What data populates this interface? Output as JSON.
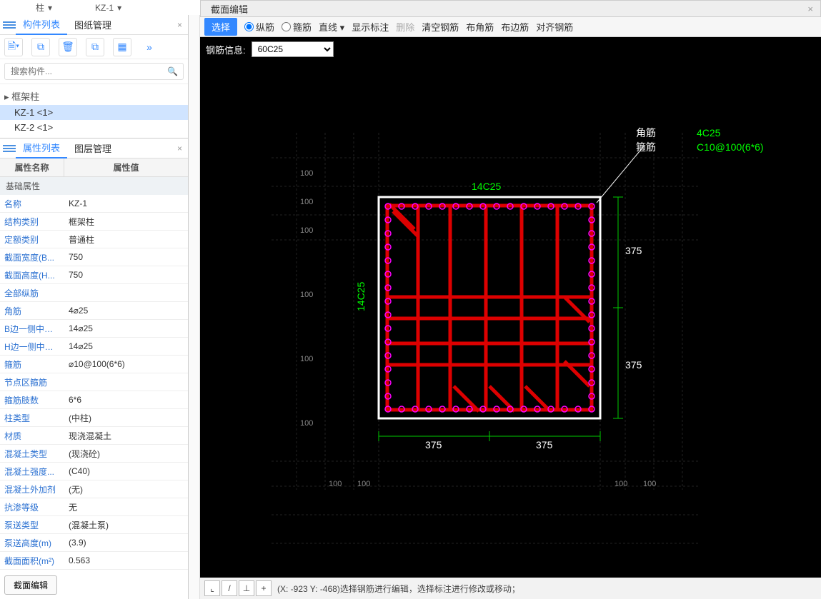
{
  "top": {
    "dd1": "柱",
    "dd2": "KZ-1"
  },
  "left_tabs": {
    "tab1": "构件列表",
    "tab2": "图纸管理"
  },
  "search": {
    "placeholder": "搜索构件..."
  },
  "tree": {
    "group": "框架柱",
    "items": [
      "KZ-1  <1>",
      "KZ-2  <1>"
    ]
  },
  "prop_tabs": {
    "tab1": "属性列表",
    "tab2": "图层管理"
  },
  "prop_head": {
    "c1": "属性名称",
    "c2": "属性值"
  },
  "prop_cat": "基础属性",
  "props": [
    {
      "n": "名称",
      "v": "KZ-1"
    },
    {
      "n": "结构类别",
      "v": "框架柱"
    },
    {
      "n": "定额类别",
      "v": "普通柱"
    },
    {
      "n": "截面宽度(B...",
      "v": "750"
    },
    {
      "n": "截面高度(H...",
      "v": "750"
    },
    {
      "n": "全部纵筋",
      "v": ""
    },
    {
      "n": "角筋",
      "v": "4⌀25"
    },
    {
      "n": "B边一侧中部筋",
      "v": "14⌀25"
    },
    {
      "n": "H边一侧中部筋",
      "v": "14⌀25"
    },
    {
      "n": "箍筋",
      "v": "⌀10@100(6*6)"
    },
    {
      "n": "节点区箍筋",
      "v": ""
    },
    {
      "n": "箍筋肢数",
      "v": "6*6"
    },
    {
      "n": "柱类型",
      "v": "(中柱)"
    },
    {
      "n": "材质",
      "v": "现浇混凝土"
    },
    {
      "n": "混凝土类型",
      "v": "(现浇砼)"
    },
    {
      "n": "混凝土强度...",
      "v": "(C40)"
    },
    {
      "n": "混凝土外加剂",
      "v": "(无)"
    },
    {
      "n": "抗渗等级",
      "v": "无"
    },
    {
      "n": "泵送类型",
      "v": "(混凝土泵)"
    },
    {
      "n": "泵送高度(m)",
      "v": "(3.9)"
    },
    {
      "n": "截面面积(m²)",
      "v": "0.563"
    }
  ],
  "edit_btn": "截面编辑",
  "rp_title": "截面编辑",
  "rp_tool": {
    "select": "选择",
    "long": "纵筋",
    "stirrup": "箍筋",
    "line": "直线",
    "show": "显示标注",
    "del": "删除",
    "clear": "清空钢筋",
    "corner": "布角筋",
    "edge": "布边筋",
    "align": "对齐钢筋"
  },
  "rp_info": {
    "label": "钢筋信息:",
    "val": "60C25"
  },
  "drawing": {
    "top_label": "14C25",
    "left_label": "14C25",
    "right_dims": [
      "375",
      "375"
    ],
    "bottom_dims": [
      "375",
      "375"
    ],
    "grid_labels": [
      "100",
      "100",
      "100",
      "100",
      "100",
      "100"
    ],
    "legend_a": "角筋",
    "legend_b": "箍筋",
    "legend_v1": "4C25",
    "legend_v2": "C10@100(6*6)"
  },
  "status": {
    "coords": "(X: -923 Y: -468)选择钢筋进行编辑，选择标注进行修改或移动；"
  }
}
